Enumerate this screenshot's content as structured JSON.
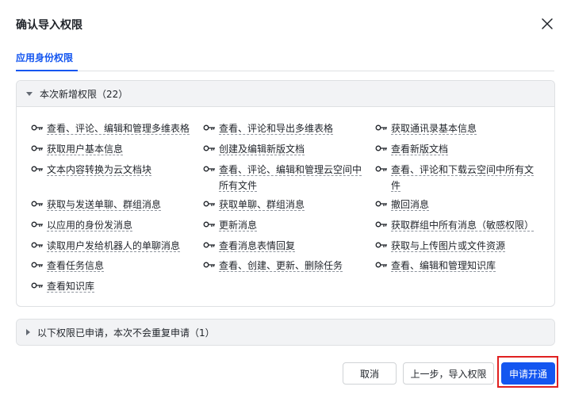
{
  "dialog": {
    "title": "确认导入权限",
    "close_icon": "close-icon"
  },
  "tabs": [
    {
      "label": "应用身份权限"
    }
  ],
  "section_new": {
    "header": "本次新增权限（22）",
    "expanded": true,
    "items": [
      "查看、评论、编辑和管理多维表格",
      "查看、评论和导出多维表格",
      "获取通讯录基本信息",
      "获取用户基本信息",
      "创建及编辑新版文档",
      "查看新版文档",
      "文本内容转换为云文档块",
      "查看、评论、编辑和管理云空间中所有文件",
      "查看、评论和下载云空间中所有文件",
      "获取与发送单聊、群组消息",
      "获取单聊、群组消息",
      "撤回消息",
      "以应用的身份发消息",
      "更新消息",
      "获取群组中所有消息（敏感权限）",
      "读取用户发给机器人的单聊消息",
      "查看消息表情回复",
      "获取与上传图片或文件资源",
      "查看任务信息",
      "查看、创建、更新、删除任务",
      "查看、编辑和管理知识库",
      "查看知识库"
    ],
    "item_icon": "key-icon"
  },
  "section_existing": {
    "header": "以下权限已申请，本次不会重复申请（1）",
    "expanded": false
  },
  "footer": {
    "cancel_label": "取消",
    "back_label": "上一步，导入权限",
    "apply_label": "申请开通"
  },
  "colors": {
    "accent": "#1456f0",
    "highlight": "#e02020",
    "section_header_bg": "#f2f3f5"
  }
}
